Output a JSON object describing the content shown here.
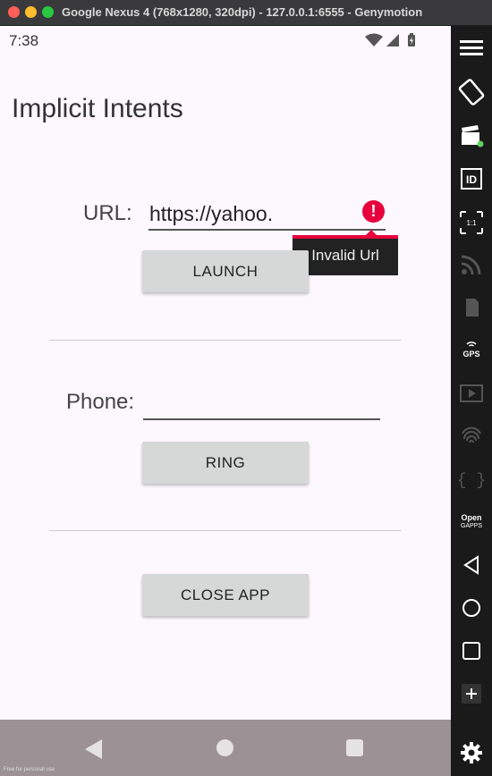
{
  "window": {
    "title": "Google Nexus 4 (768x1280, 320dpi) - 127.0.0.1:6555 - Genymotion"
  },
  "status_bar": {
    "time": "7:38"
  },
  "app": {
    "title": "Implicit Intents",
    "url_label": "URL:",
    "url_value": "https://yahoo.",
    "error_tooltip": "Invalid Url",
    "launch_button": "LAUNCH",
    "phone_label": "Phone:",
    "phone_value": "",
    "ring_button": "RING",
    "close_button": "CLOSE APP"
  },
  "footer_note": "Free for personal use",
  "sidebar": {
    "items": [
      "menu-icon",
      "rotate-icon",
      "camera-icon",
      "id-icon",
      "pixel-perfect-icon",
      "wifi-signal-icon",
      "sim-icon",
      "gps-icon",
      "video-icon",
      "fingerprint-icon",
      "code-icon",
      "open-gapps-icon",
      "back-icon",
      "home-icon",
      "recent-icon",
      "add-icon",
      "settings-icon"
    ],
    "gps_label": "GPS",
    "id_label": "ID",
    "ratio_label": "1:1",
    "opengapps_label": "Open",
    "opengapps_sub": "GAPPS"
  },
  "colors": {
    "error": "#e8003d",
    "app_background": "#fdf7fe",
    "button": "#d6d7d7",
    "navbar": "#9c9195"
  }
}
